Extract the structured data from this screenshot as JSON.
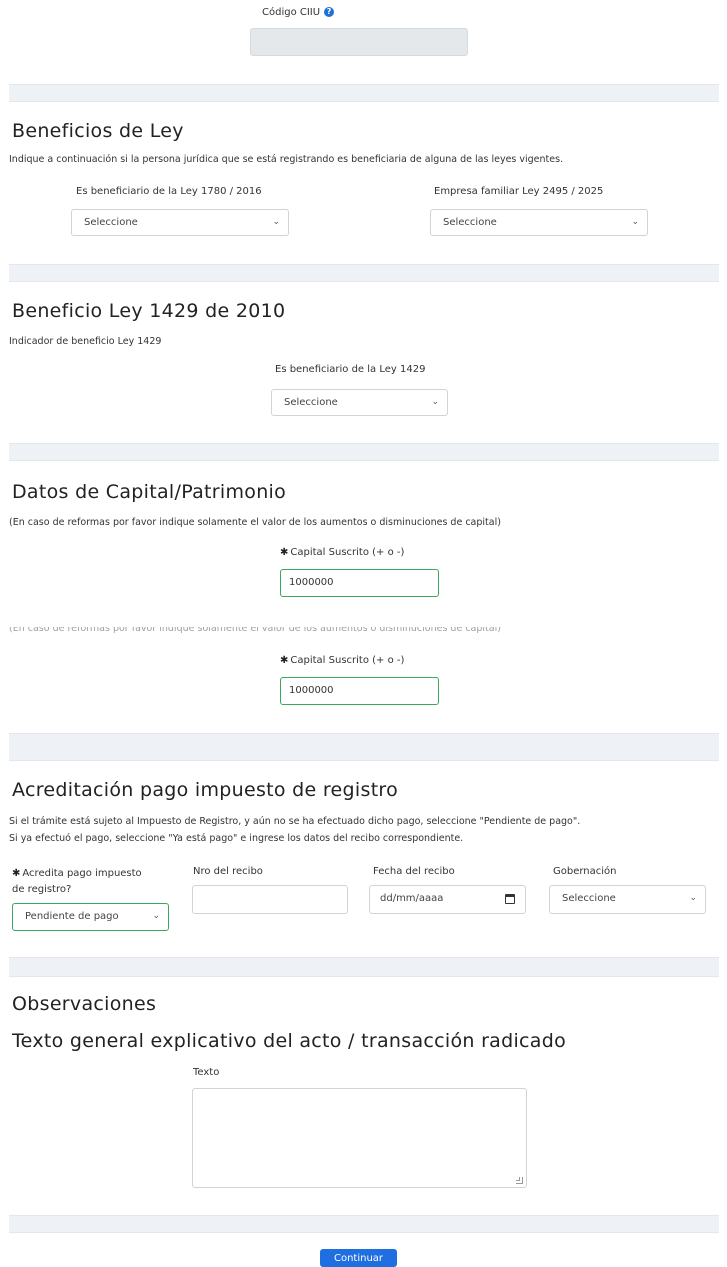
{
  "ciiu": {
    "label": "Código CIIU",
    "help_icon": "question-circle-icon"
  },
  "beneficios": {
    "title": "Beneficios de Ley",
    "description": "Indique a continuación si la persona jurídica que se está registrando es beneficiaria de alguna de las leyes vigentes.",
    "field1_label": "Es beneficiario de la Ley 1780 / 2016",
    "field1_value": "Seleccione",
    "field2_label": "Empresa familiar Ley 2495 / 2025",
    "field2_value": "Seleccione"
  },
  "ley1429": {
    "title": "Beneficio Ley 1429 de 2010",
    "indicator": "Indicador de beneficio Ley 1429",
    "field_label": "Es beneficiario de la Ley 1429",
    "field_value": "Seleccione"
  },
  "capital": {
    "title": "Datos de Capital/Patrimonio",
    "note": "(En caso de reformas por favor indique solamente el valor de los aumentos o disminuciones de capital)",
    "field_label": "Capital Suscrito (+ o -)",
    "field_value": "1000000",
    "note2": "(En caso de reformas por favor indique solamente el valor de los aumentos o disminuciones de capital)",
    "field2_label": "Capital Suscrito (+ o -)",
    "field2_value": "1000000"
  },
  "impuesto": {
    "title": "Acreditación pago impuesto de registro",
    "line1": "Si el trámite está sujeto al Impuesto de Registro, y aún no se ha efectuado dicho pago, seleccione \"Pendiente de pago\".",
    "line2": "Si ya efectuó el pago, seleccione \"Ya está pago\" e ingrese los datos del recibo correspondiente.",
    "acredita_label_1": "Acredita pago impuesto",
    "acredita_label_2": "de registro?",
    "acredita_value": "Pendiente de pago",
    "recibo_label": "Nro del recibo",
    "recibo_value": "",
    "fecha_label": "Fecha del recibo",
    "fecha_placeholder": "dd/mm/aaaa",
    "gobernacion_label": "Gobernación",
    "gobernacion_value": "Seleccione"
  },
  "observaciones": {
    "title": "Observaciones",
    "subtitle": "Texto general explicativo del acto / transacción radicado",
    "texto_label": "Texto"
  },
  "actions": {
    "continuar": "Continuar"
  },
  "colors": {
    "accent": "#1f6fe0",
    "valid_border": "#3aa85b",
    "band": "#eef1f5"
  }
}
